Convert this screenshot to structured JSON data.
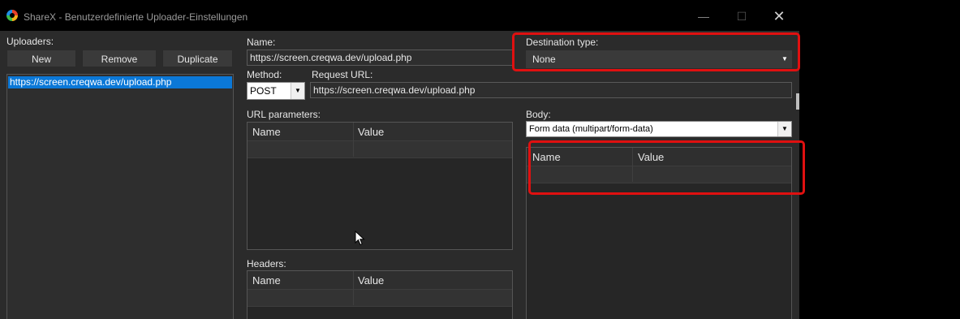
{
  "window": {
    "title": "ShareX - Benutzerdefinierte Uploader-Einstellungen",
    "minimize": "—",
    "maximize": "☐",
    "close": "✕"
  },
  "uploaders": {
    "label": "Uploaders:",
    "buttons": {
      "new": "New",
      "remove": "Remove",
      "duplicate": "Duplicate"
    },
    "items": [
      "https://screen.creqwa.dev/upload.php"
    ]
  },
  "form": {
    "name_label": "Name:",
    "name_value": "https://screen.creqwa.dev/upload.php",
    "destination_type_label": "Destination type:",
    "destination_type_value": "None",
    "method_label": "Method:",
    "method_value": "POST",
    "request_url_label": "Request URL:",
    "request_url_value": "https://screen.creqwa.dev/upload.php",
    "url_parameters_label": "URL parameters:",
    "headers_label": "Headers:",
    "body_label": "Body:",
    "body_value": "Form data (multipart/form-data)"
  },
  "grid_columns": {
    "name": "Name",
    "value": "Value"
  },
  "colors": {
    "highlight": "#e01010",
    "selection": "#0b78d7"
  }
}
